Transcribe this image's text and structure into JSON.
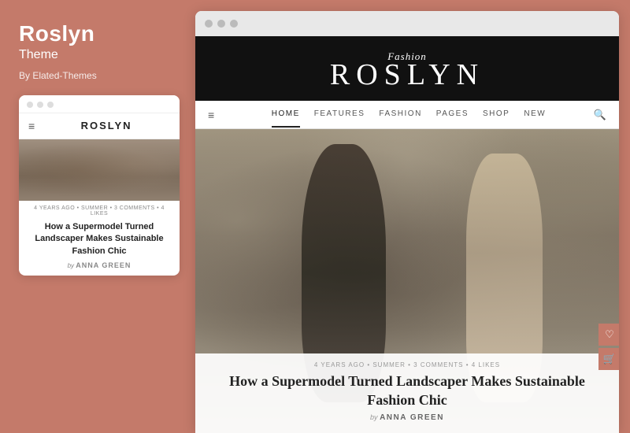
{
  "left": {
    "title": "Roslyn",
    "subtitle": "Theme",
    "by": "By Elated-Themes",
    "mobile": {
      "dots": [
        "dot1",
        "dot2",
        "dot3"
      ],
      "logo": "ROSLYN",
      "meta": "4 YEARS AGO • SUMMER • 3 COMMENTS • 4 LIKES",
      "article_title": "How a Supermodel Turned Landscaper Makes Sustainable Fashion Chic",
      "by_label": "by",
      "author": "ANNA GREEN"
    }
  },
  "browser": {
    "dots": [
      "dot1",
      "dot2",
      "dot3"
    ]
  },
  "site": {
    "logo_script": "Fashion",
    "logo_main": "ROSLYN",
    "nav": {
      "hamburger": "≡",
      "items": [
        {
          "label": "HOME",
          "active": true
        },
        {
          "label": "FEATURES",
          "active": false
        },
        {
          "label": "FASHION",
          "active": false
        },
        {
          "label": "PAGES",
          "active": false
        },
        {
          "label": "SHOP",
          "active": false
        },
        {
          "label": "NEW",
          "active": false
        }
      ],
      "search_icon": "🔍"
    },
    "article": {
      "meta": "4 YEARS AGO • SUMMER • 3 COMMENTS • 4 LIKES",
      "title": "How a Supermodel Turned Landscaper Makes Sustainable Fashion Chic",
      "by_label": "by",
      "author": "ANNA GREEN"
    }
  },
  "side_buttons": {
    "wishlist_icon": "♡",
    "cart_icon": "🛒"
  }
}
